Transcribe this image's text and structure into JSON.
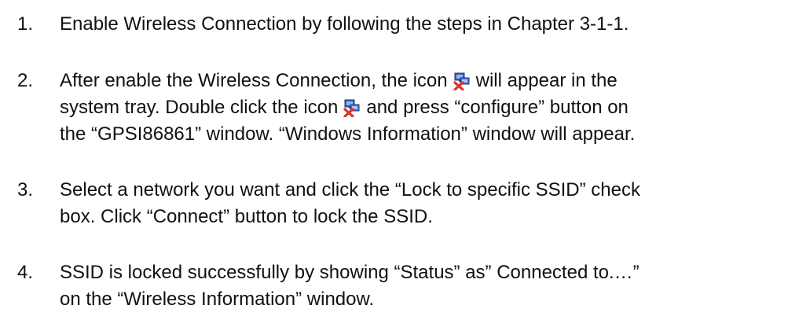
{
  "steps": [
    {
      "number": "1.",
      "lines": [
        "Enable Wireless Connection by following the steps in Chapter 3-1-1."
      ]
    },
    {
      "number": "2.",
      "line1_before_icon": "After enable the Wireless Connection, the icon",
      "line1_after_icon": "will appear in the",
      "line2_before_icon": "system tray. Double click the icon",
      "line2_after_icon": "and press “configure” button on",
      "line3": "the “GPSI86861” window. “Windows Information” window will appear."
    },
    {
      "number": "3.",
      "lines": [
        "Select a network you want and click the “Lock to specific SSID” check",
        "box. Click “Connect” button to lock the SSID."
      ]
    },
    {
      "number": "4.",
      "lines": [
        "SSID is locked successfully by showing “Status” as” Connected to.…”",
        "on the “Wireless Information” window."
      ]
    }
  ],
  "icons": {
    "tray_icon": "wireless-disconnected-tray-icon"
  },
  "colors": {
    "text": "#111111",
    "icon_monitor": "#3a5fb0",
    "icon_cross": "#e0342c"
  }
}
